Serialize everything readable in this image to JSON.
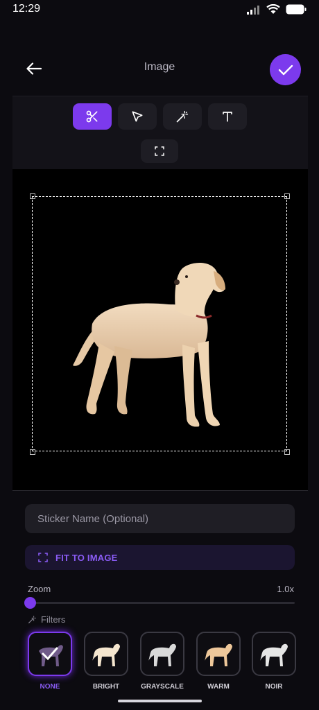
{
  "status_bar": {
    "time": "12:29"
  },
  "header": {
    "title": "Image"
  },
  "toolbar": {
    "tools": [
      {
        "icon": "scissors-icon",
        "active": true
      },
      {
        "icon": "pointer-icon",
        "active": false
      },
      {
        "icon": "magic-wand-icon",
        "active": false
      },
      {
        "icon": "text-icon",
        "active": false
      },
      {
        "icon": "fullscreen-icon",
        "active": false
      }
    ]
  },
  "form": {
    "sticker_name_placeholder": "Sticker Name (Optional)",
    "sticker_name_value": "",
    "fit_label": "FIT TO IMAGE"
  },
  "zoom": {
    "label": "Zoom",
    "value_text": "1.0x",
    "level": 0.0
  },
  "filters": {
    "label": "Filters",
    "items": [
      {
        "name": "NONE",
        "selected": true
      },
      {
        "name": "BRIGHT",
        "selected": false
      },
      {
        "name": "GRAYSCALE",
        "selected": false
      },
      {
        "name": "WARM",
        "selected": false
      },
      {
        "name": "NOIR",
        "selected": false
      }
    ]
  },
  "colors": {
    "accent": "#7c3aed",
    "background": "#0c0b10",
    "canvas": "#000000"
  }
}
